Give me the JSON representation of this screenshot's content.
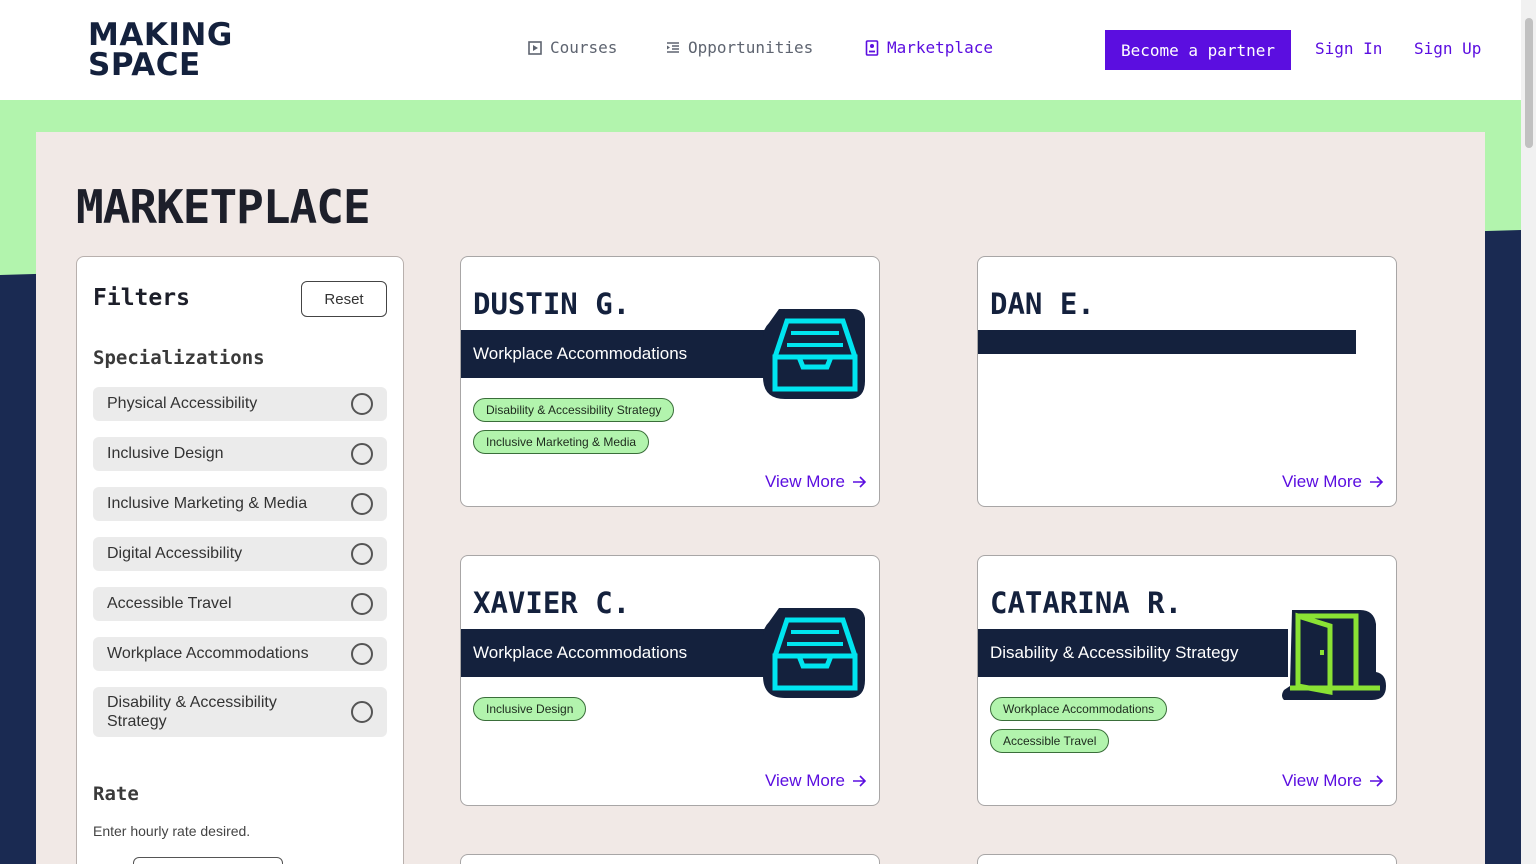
{
  "header": {
    "logo_line1": "MAKING",
    "logo_line2": "SPACE",
    "nav": [
      {
        "label": "Courses",
        "icon": "play-square-icon"
      },
      {
        "label": "Opportunities",
        "icon": "list-indent-icon"
      },
      {
        "label": "Marketplace",
        "icon": "id-badge-icon",
        "active": true
      }
    ],
    "partner_label": "Become a partner",
    "signin_label": "Sign In",
    "signup_label": "Sign Up"
  },
  "page": {
    "title": "MARKETPLACE"
  },
  "filters": {
    "title": "Filters",
    "reset_label": "Reset",
    "specializations_title": "Specializations",
    "specializations": [
      "Physical Accessibility",
      "Inclusive Design",
      "Inclusive Marketing & Media",
      "Digital Accessibility",
      "Accessible Travel",
      "Workplace Accommodations",
      "Disability & Accessibility Strategy"
    ],
    "rate_title": "Rate",
    "rate_desc": "Enter hourly rate desired."
  },
  "cards": [
    {
      "name": "DUSTIN G.",
      "specialty": "Workplace Accommodations",
      "icon": "inbox-tray-icon",
      "tags": [
        "Disability & Accessibility Strategy",
        "Inclusive Marketing & Media"
      ],
      "view_more": "View More"
    },
    {
      "name": "DAN E.",
      "specialty": "",
      "icon": "",
      "tags": [],
      "view_more": "View More"
    },
    {
      "name": "XAVIER C.",
      "specialty": "Workplace Accommodations",
      "icon": "inbox-tray-icon",
      "tags": [
        "Inclusive Design"
      ],
      "view_more": "View More"
    },
    {
      "name": "CATARINA R.",
      "specialty": "Disability & Accessibility Strategy",
      "icon": "open-door-icon",
      "tags": [
        "Workplace Accommodations",
        "Accessible Travel"
      ],
      "view_more": "View More"
    }
  ],
  "colors": {
    "brand_purple": "#5b0ee0",
    "navy": "#14213d",
    "green": "#b2f4ad",
    "cyan_icon": "#00e5f0",
    "lime_icon": "#8ae234"
  }
}
